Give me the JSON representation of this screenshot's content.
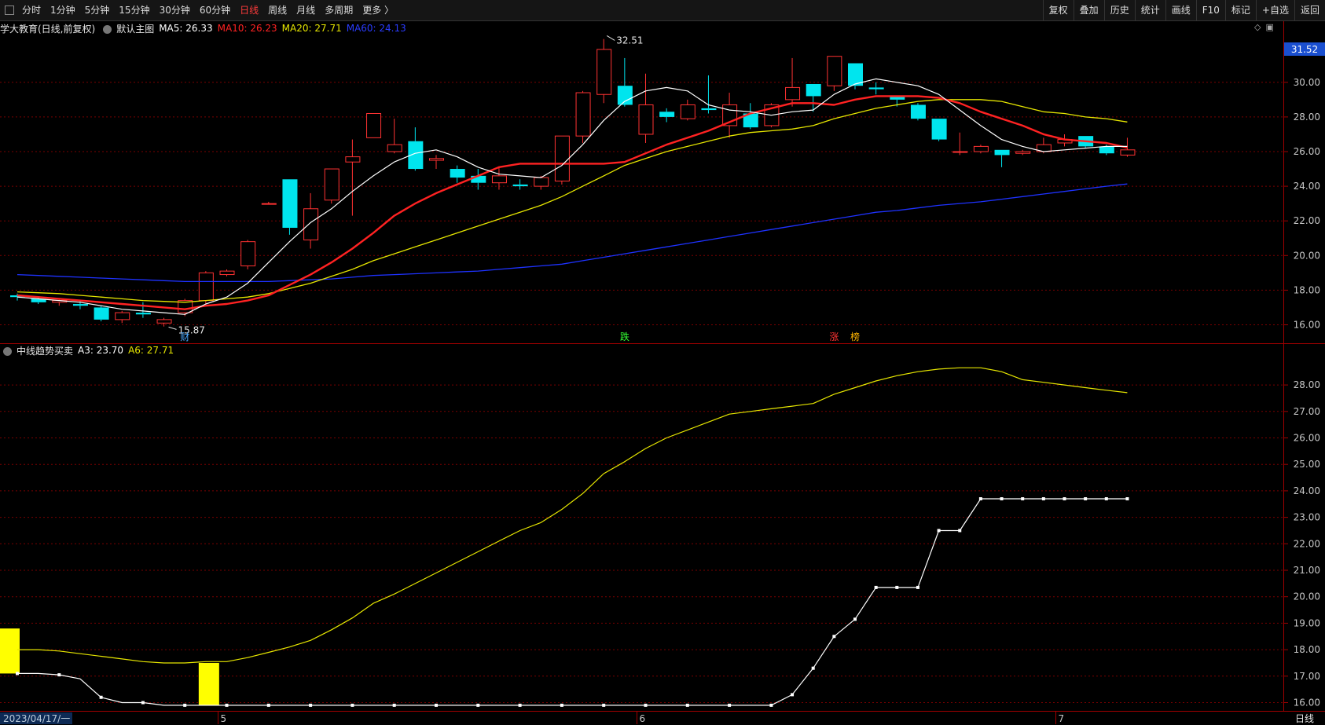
{
  "toolbar": {
    "periods": [
      {
        "label": "分时"
      },
      {
        "label": "1分钟"
      },
      {
        "label": "5分钟"
      },
      {
        "label": "15分钟"
      },
      {
        "label": "30分钟"
      },
      {
        "label": "60分钟"
      },
      {
        "label": "日线",
        "active": true
      },
      {
        "label": "周线"
      },
      {
        "label": "月线"
      },
      {
        "label": "多周期"
      },
      {
        "label": "更多 〉"
      }
    ],
    "right_buttons": [
      "复权",
      "叠加",
      "历史",
      "统计",
      "画线",
      "F10",
      "标记",
      "+自选",
      "返回"
    ]
  },
  "main_info": {
    "title": "学大教育(日线,前复权)",
    "chart_name": "默认主图",
    "ma5": "MA5: 26.33",
    "ma10": "MA10: 26.23",
    "ma20": "MA20: 27.71",
    "ma60": "MA60: 24.13"
  },
  "indicator_info": {
    "name": "中线趋势买卖",
    "a3": "A3: 23.70",
    "a6": "A6: 27.71"
  },
  "colors": {
    "up": "#ff3232",
    "down": "#00e5ee",
    "ma5": "#ffffff",
    "ma10": "#ff2222",
    "ma20": "#e6e600",
    "ma60": "#1e32ff",
    "grid": "#7a0000",
    "a6": "#e6e600",
    "a3": "#ffffff",
    "bar": "#ffff00"
  },
  "status_bar": {
    "start_date": "2023/04/17/一",
    "month_marks": [
      "5",
      "6",
      "7"
    ],
    "period_label": "日线"
  },
  "chart_data": [
    {
      "type": "candlestick",
      "title": "学大教育(日线,前复权)",
      "yaxis_ticks": [
        "16.00",
        "18.00",
        "20.00",
        "22.00",
        "24.00",
        "26.00",
        "28.00",
        "30.00"
      ],
      "ylim": [
        15.0,
        34.0
      ],
      "last_price_tag": "31.52",
      "high_annotation": "32.51",
      "low_annotation": "15.87",
      "event_marks": [
        {
          "index": 8,
          "text": "财",
          "color": "#4aa8ff"
        },
        {
          "index": 29,
          "text": "跌",
          "color": "#33ff33"
        },
        {
          "index": 39,
          "text": "涨",
          "color": "#ff3333"
        },
        {
          "index": 40,
          "text": "榜",
          "color": "#ffb400"
        }
      ],
      "candles": [
        [
          17.7,
          17.6,
          17.8,
          17.4
        ],
        [
          17.5,
          17.3,
          17.6,
          17.2
        ],
        [
          17.3,
          17.4,
          17.5,
          17.1
        ],
        [
          17.2,
          17.1,
          17.4,
          16.9
        ],
        [
          17.0,
          16.3,
          17.1,
          16.2
        ],
        [
          16.3,
          16.7,
          16.8,
          16.1
        ],
        [
          16.7,
          16.6,
          17.3,
          16.4
        ],
        [
          16.1,
          16.3,
          16.4,
          15.9
        ],
        [
          16.7,
          17.4,
          17.5,
          16.5
        ],
        [
          17.4,
          19.0,
          19.1,
          17.2
        ],
        [
          18.9,
          19.1,
          19.2,
          18.8
        ],
        [
          19.4,
          20.8,
          20.9,
          19.2
        ],
        [
          23.0,
          23.0,
          23.1,
          23.0
        ],
        [
          24.4,
          21.6,
          24.4,
          21.2
        ],
        [
          20.9,
          22.7,
          23.6,
          20.4
        ],
        [
          23.2,
          25.0,
          25.0,
          23.0
        ],
        [
          25.4,
          25.7,
          26.7,
          22.3
        ],
        [
          26.8,
          28.2,
          28.2,
          26.8
        ],
        [
          26.0,
          26.4,
          27.9,
          25.9
        ],
        [
          26.6,
          25.0,
          27.4,
          24.9
        ],
        [
          25.5,
          25.6,
          25.8,
          25.0
        ],
        [
          25.0,
          24.5,
          25.2,
          24.2
        ],
        [
          24.6,
          24.2,
          25.0,
          23.8
        ],
        [
          24.2,
          24.6,
          25.1,
          23.8
        ],
        [
          24.1,
          24.0,
          24.4,
          23.8
        ],
        [
          24.0,
          24.5,
          24.6,
          23.8
        ],
        [
          24.3,
          26.9,
          26.9,
          24.1
        ],
        [
          26.9,
          29.4,
          29.5,
          26.5
        ],
        [
          29.3,
          31.9,
          32.5,
          28.8
        ],
        [
          29.8,
          28.7,
          31.4,
          28.6
        ],
        [
          27.0,
          28.7,
          30.5,
          26.5
        ],
        [
          28.3,
          28.0,
          28.5,
          27.7
        ],
        [
          27.9,
          28.7,
          29.0,
          27.8
        ],
        [
          28.5,
          28.4,
          30.4,
          28.2
        ],
        [
          27.5,
          28.7,
          29.4,
          26.8
        ],
        [
          28.2,
          27.4,
          28.8,
          27.3
        ],
        [
          27.5,
          28.7,
          28.8,
          27.4
        ],
        [
          29.0,
          29.7,
          31.4,
          28.6
        ],
        [
          29.9,
          29.2,
          29.9,
          28.3
        ],
        [
          29.8,
          31.5,
          31.5,
          29.5
        ],
        [
          31.1,
          29.8,
          31.1,
          29.6
        ],
        [
          29.7,
          29.6,
          30.0,
          29.3
        ],
        [
          29.2,
          29.0,
          29.2,
          28.6
        ],
        [
          28.7,
          27.9,
          28.8,
          27.8
        ],
        [
          27.9,
          26.7,
          27.9,
          26.6
        ],
        [
          26.0,
          26.0,
          27.1,
          25.8
        ],
        [
          26.0,
          26.3,
          26.4,
          25.9
        ],
        [
          26.1,
          25.8,
          26.1,
          25.1
        ],
        [
          25.9,
          26.0,
          26.1,
          25.8
        ],
        [
          26.0,
          26.4,
          26.8,
          25.9
        ],
        [
          26.5,
          26.7,
          27.0,
          26.3
        ],
        [
          26.9,
          26.3,
          26.9,
          26.2
        ],
        [
          26.3,
          25.9,
          26.4,
          25.8
        ],
        [
          25.8,
          26.1,
          26.8,
          25.7
        ]
      ],
      "ma5": [
        17.6,
        17.5,
        17.4,
        17.3,
        17.1,
        16.9,
        16.8,
        16.7,
        16.6,
        17.2,
        17.6,
        18.4,
        19.6,
        20.8,
        21.9,
        22.7,
        23.7,
        24.6,
        25.4,
        25.9,
        26.1,
        25.7,
        25.1,
        24.7,
        24.6,
        24.5,
        25.2,
        26.4,
        27.8,
        28.9,
        29.5,
        29.7,
        29.5,
        28.7,
        28.4,
        28.3,
        28.1,
        28.3,
        28.4,
        29.3,
        29.9,
        30.2,
        30.0,
        29.8,
        29.3,
        28.4,
        27.5,
        26.7,
        26.3,
        26.0,
        26.1,
        26.2,
        26.3,
        26.3
      ],
      "ma10": [
        17.7,
        17.6,
        17.5,
        17.4,
        17.3,
        17.2,
        17.1,
        17.0,
        16.9,
        17.1,
        17.2,
        17.4,
        17.7,
        18.3,
        18.9,
        19.6,
        20.4,
        21.3,
        22.3,
        23.0,
        23.6,
        24.1,
        24.6,
        25.1,
        25.3,
        25.3,
        25.3,
        25.3,
        25.3,
        25.4,
        25.9,
        26.4,
        26.8,
        27.2,
        27.7,
        28.2,
        28.5,
        28.8,
        28.8,
        28.7,
        29.0,
        29.2,
        29.2,
        29.2,
        29.1,
        28.8,
        28.3,
        27.9,
        27.5,
        27.0,
        26.7,
        26.6,
        26.5,
        26.23
      ],
      "ma20": [
        17.9,
        17.85,
        17.8,
        17.7,
        17.6,
        17.5,
        17.4,
        17.35,
        17.3,
        17.4,
        17.5,
        17.6,
        17.8,
        18.1,
        18.4,
        18.8,
        19.2,
        19.7,
        20.1,
        20.5,
        20.9,
        21.3,
        21.7,
        22.1,
        22.5,
        22.9,
        23.4,
        24.0,
        24.6,
        25.2,
        25.6,
        26.0,
        26.3,
        26.6,
        26.9,
        27.1,
        27.2,
        27.3,
        27.5,
        27.9,
        28.2,
        28.5,
        28.7,
        28.9,
        29.0,
        29.0,
        29.0,
        28.9,
        28.6,
        28.3,
        28.2,
        28.0,
        27.9,
        27.71
      ],
      "ma60": [
        18.9,
        18.85,
        18.8,
        18.75,
        18.7,
        18.65,
        18.6,
        18.55,
        18.5,
        18.5,
        18.5,
        18.5,
        18.5,
        18.55,
        18.6,
        18.65,
        18.75,
        18.85,
        18.9,
        18.95,
        19.0,
        19.05,
        19.1,
        19.2,
        19.3,
        19.4,
        19.5,
        19.7,
        19.9,
        20.1,
        20.3,
        20.5,
        20.7,
        20.9,
        21.1,
        21.3,
        21.5,
        21.7,
        21.9,
        22.1,
        22.3,
        22.5,
        22.6,
        22.75,
        22.9,
        23.0,
        23.1,
        23.25,
        23.4,
        23.55,
        23.7,
        23.85,
        24.0,
        24.13
      ]
    },
    {
      "type": "line",
      "title": "中线趋势买卖",
      "yaxis_ticks": [
        "16.00",
        "17.00",
        "18.00",
        "19.00",
        "20.00",
        "21.00",
        "22.00",
        "23.00",
        "24.00",
        "25.00",
        "26.00",
        "27.00",
        "28.00"
      ],
      "ylim": [
        15.7,
        29.0
      ],
      "series": [
        {
          "name": "A6",
          "values": [
            18.0,
            18.0,
            17.95,
            17.85,
            17.75,
            17.65,
            17.55,
            17.5,
            17.5,
            17.55,
            17.55,
            17.7,
            17.9,
            18.1,
            18.35,
            18.75,
            19.2,
            19.75,
            20.1,
            20.5,
            20.9,
            21.3,
            21.7,
            22.1,
            22.5,
            22.8,
            23.3,
            23.9,
            24.65,
            25.1,
            25.6,
            26.0,
            26.3,
            26.6,
            26.9,
            27.0,
            27.1,
            27.2,
            27.3,
            27.65,
            27.9,
            28.15,
            28.35,
            28.5,
            28.6,
            28.65,
            28.65,
            28.5,
            28.2,
            28.1,
            28.0,
            27.9,
            27.8,
            27.71
          ]
        },
        {
          "name": "A3",
          "values": [
            17.1,
            17.1,
            17.05,
            16.9,
            16.2,
            16.0,
            16.0,
            15.9,
            15.9,
            15.9,
            15.9,
            15.9,
            15.9,
            15.9,
            15.9,
            15.9,
            15.9,
            15.9,
            15.9,
            15.9,
            15.9,
            15.9,
            15.9,
            15.9,
            15.9,
            15.9,
            15.9,
            15.9,
            15.9,
            15.9,
            15.9,
            15.9,
            15.9,
            15.9,
            15.9,
            15.9,
            15.9,
            16.3,
            17.3,
            18.5,
            19.15,
            20.35,
            20.35,
            20.35,
            22.5,
            22.5,
            23.7,
            23.7,
            23.7,
            23.7,
            23.7,
            23.7,
            23.7,
            23.7
          ]
        }
      ],
      "bars": [
        {
          "index": 0,
          "from": 17.1,
          "to": 18.8
        },
        {
          "index": 9,
          "from": 15.9,
          "to": 17.5
        }
      ]
    }
  ]
}
